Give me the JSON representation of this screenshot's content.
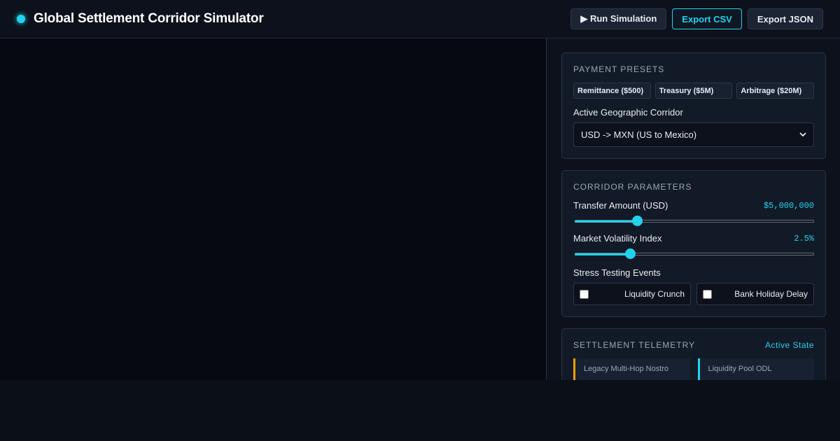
{
  "header": {
    "title": "Global Settlement Corridor Simulator",
    "run_label": "▶ Run Simulation",
    "export_csv_label": "Export CSV",
    "export_json_label": "Export JSON"
  },
  "presets": {
    "title": "PAYMENT PRESETS",
    "items": [
      {
        "label": "Remittance ($500)"
      },
      {
        "label": "Treasury ($5M)"
      },
      {
        "label": "Arbitrage ($20M)"
      }
    ],
    "corridor_label": "Active Geographic Corridor",
    "corridor_value": "USD -> MXN (US to Mexico)"
  },
  "parameters": {
    "title": "CORRIDOR PARAMETERS",
    "transfer": {
      "label": "Transfer Amount (USD)",
      "value_text": "$5,000,000",
      "fraction": 0.25
    },
    "volatility": {
      "label": "Market Volatility Index",
      "value_text": "2.5%",
      "fraction": 0.22
    },
    "stress_label": "Stress Testing Events",
    "stress_events": [
      {
        "label": "Liquidity Crunch",
        "checked": false
      },
      {
        "label": "Bank Holiday Delay",
        "checked": false
      }
    ]
  },
  "telemetry": {
    "title": "SETTLEMENT TELEMETRY",
    "state": "Active State",
    "tiles": [
      {
        "label": "Legacy Multi-Hop Nostro"
      },
      {
        "label": "Liquidity Pool ODL"
      }
    ]
  },
  "colors": {
    "accent": "#22d3ee",
    "warning": "#f59e0b"
  }
}
